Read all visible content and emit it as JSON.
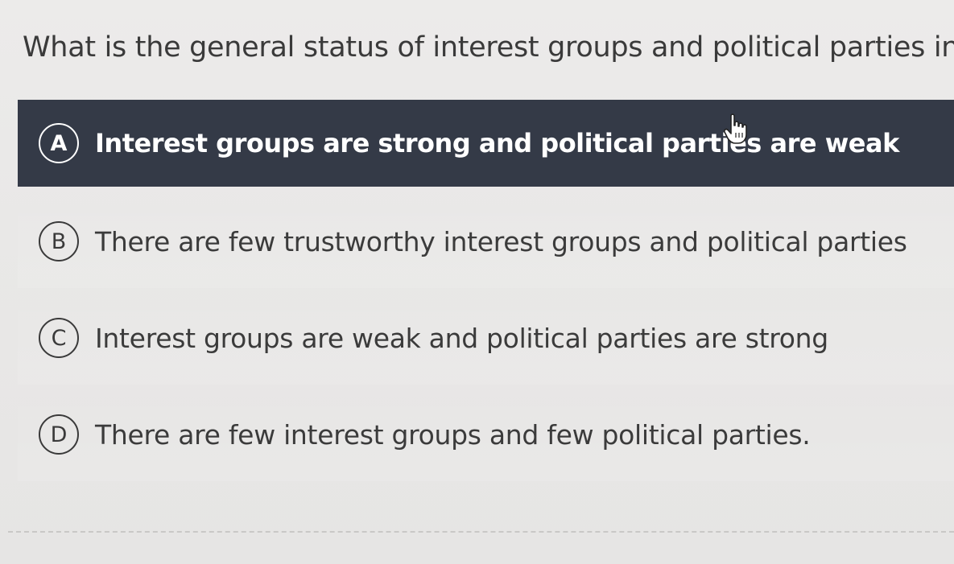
{
  "question": {
    "text": "What is the general status of interest groups and political parties in Texa"
  },
  "options": [
    {
      "letter": "A",
      "text": "Interest groups are strong and political parties are weak",
      "selected": true
    },
    {
      "letter": "B",
      "text": "There are few trustworthy interest groups and political parties",
      "selected": false
    },
    {
      "letter": "C",
      "text": "Interest groups are weak and political parties are strong",
      "selected": false
    },
    {
      "letter": "D",
      "text": "There are few interest groups and few political parties.",
      "selected": false
    }
  ],
  "colors": {
    "selected_background": "#343a47",
    "selected_text": "#ffffff",
    "text": "#3a3a3a",
    "page_background": "#ebeae9"
  },
  "icons": {
    "cursor": "hand-pointer-icon"
  }
}
